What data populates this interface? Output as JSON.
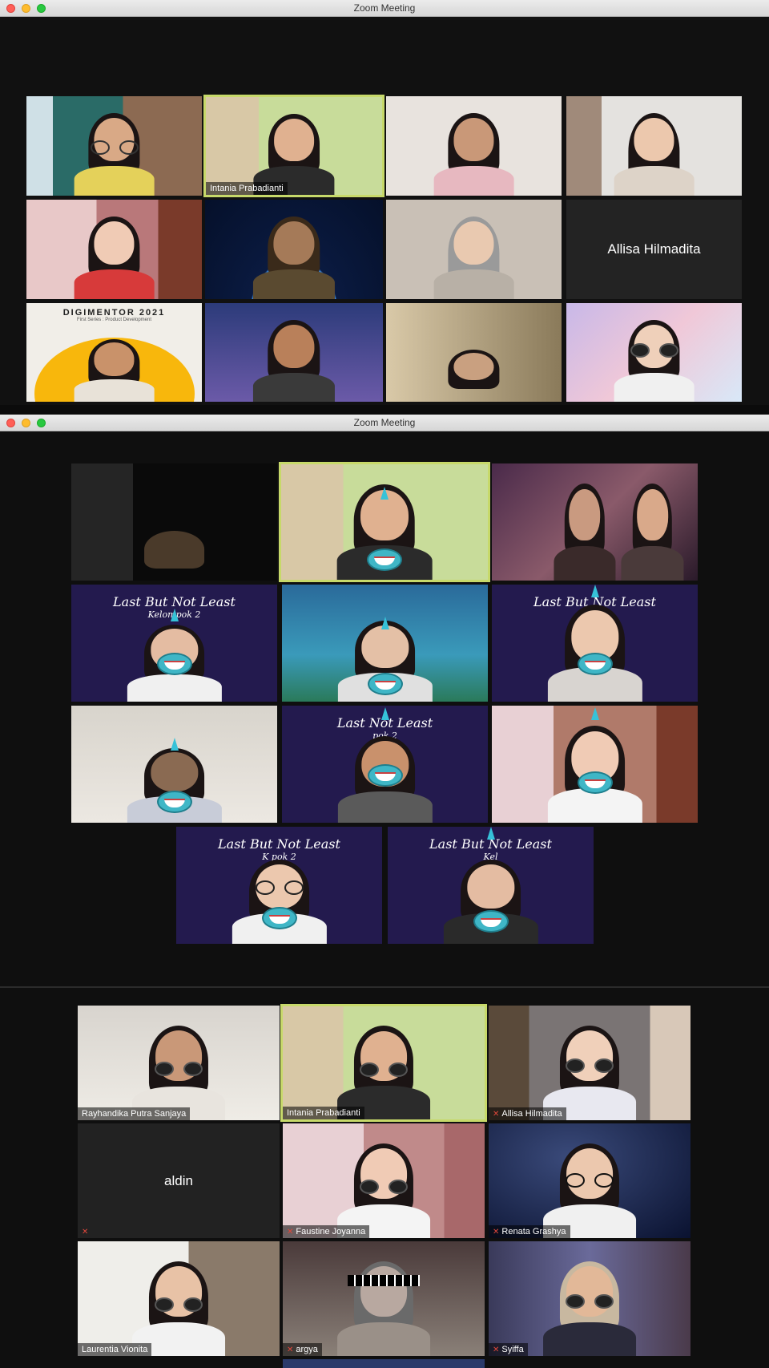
{
  "window1": {
    "title": "Zoom Meeting"
  },
  "window2": {
    "title": "Zoom Meeting"
  },
  "gallery1": {
    "tiles": [
      {
        "name": ""
      },
      {
        "name": "Intania Prabadianti"
      },
      {
        "name": ""
      },
      {
        "name": ""
      },
      {
        "name": ""
      },
      {
        "name": ""
      },
      {
        "name": ""
      },
      {
        "name": "Allisa Hilmadita"
      },
      {
        "name": ""
      },
      {
        "name": ""
      },
      {
        "name": ""
      },
      {
        "name": ""
      }
    ],
    "digimentor": {
      "title": "DIGIMENTOR 2021",
      "subtitle": "First Series : Product Development"
    }
  },
  "gallery2": {
    "banner_text": "Last But Not Least",
    "banner_sub": "Kelompok 2",
    "banner_partial_1": "Last But Not Least",
    "banner_partial_1_sub": "Kel",
    "banner_partial_2": "Last But Not Least",
    "banner_partial_2_sub": "Kel",
    "banner_partial_3": "Last    Not Least",
    "banner_partial_3_sub": "     pok 2",
    "banner_partial_4": "Last But Not Least",
    "banner_partial_4_sub": "K     pok 2",
    "banner_partial_5": "Last But Not Least",
    "banner_partial_5_sub": "Kel"
  },
  "gallery3": {
    "tiles": [
      {
        "name": "Rayhandika Putra Sanjaya"
      },
      {
        "name": "Intania Prabadianti"
      },
      {
        "name": "Allisa Hilmadita"
      },
      {
        "name": "aldin"
      },
      {
        "name": "Faustine Joyanna"
      },
      {
        "name": "Renata Grashya"
      },
      {
        "name": "Laurentia Vionita"
      },
      {
        "name": "argya"
      },
      {
        "name": "Syiffa"
      }
    ]
  },
  "colors": {
    "active_border": "#c7d96a",
    "mute_icon": "#e0473b",
    "shark": "#3fb6c6"
  }
}
